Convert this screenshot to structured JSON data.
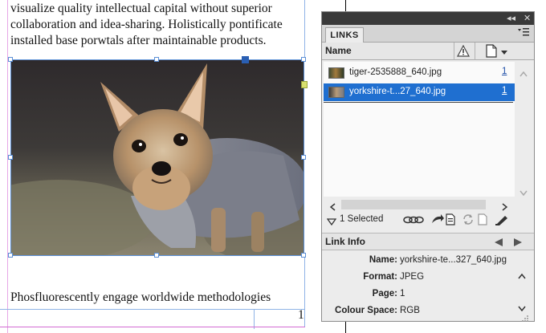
{
  "document": {
    "paragraph_lines": [
      "visualize quality intellectual capital without superior",
      "collaboration and idea-sharing. Holistically pontificate",
      "installed base porwtals after maintainable products."
    ],
    "bottom_line": "Phosfluorescently engage worldwide methodologies",
    "page_number": "1"
  },
  "panel": {
    "title_buttons": {
      "collapse": "◂◂",
      "close": "✕"
    },
    "tab_label": "LINKS",
    "menu_icon": "hamburger-menu-icon",
    "columns": {
      "name": "Name",
      "status_icon": "warning-icon",
      "page_icon": "page-icon"
    },
    "links": [
      {
        "name": "tiger-2535888_640.jpg",
        "page": "1",
        "selected": false
      },
      {
        "name": "yorkshire-t...27_640.jpg",
        "page": "1",
        "selected": true
      }
    ],
    "status": {
      "selected_text": "1 Selected"
    },
    "link_info": {
      "title": "Link Info",
      "fields": [
        {
          "label": "Name:",
          "value": "yorkshire-te...327_640.jpg"
        },
        {
          "label": "Format:",
          "value": "JPEG"
        },
        {
          "label": "Page:",
          "value": "1"
        },
        {
          "label": "Colour Space:",
          "value": "RGB"
        }
      ]
    }
  },
  "colors": {
    "selection": "#1f6fd0",
    "frame": "#5b8fd6",
    "guide_magenta": "#d26ad2"
  }
}
